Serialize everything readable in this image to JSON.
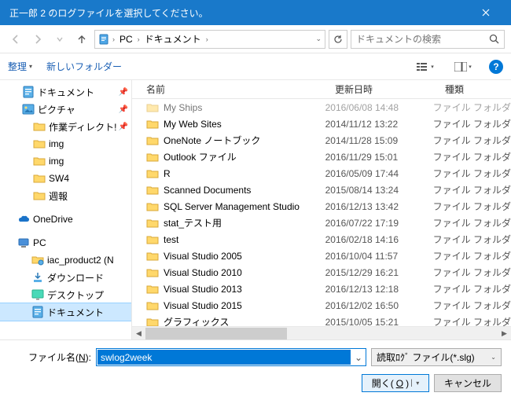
{
  "title": "正一郎 2 のログファイルを選択してください。",
  "breadcrumb": {
    "root": "PC",
    "folder": "ドキュメント"
  },
  "search_placeholder": "ドキュメントの検索",
  "toolbar": {
    "organize": "整理",
    "newfolder": "新しいフォルダー"
  },
  "columns": {
    "name": "名前",
    "date": "更新日時",
    "type": "種類"
  },
  "tree": [
    {
      "label": "ドキュメント",
      "icon": "doc",
      "indent": 28,
      "pin": true
    },
    {
      "label": "ピクチャ",
      "icon": "pic",
      "indent": 28,
      "pin": true
    },
    {
      "label": "作業ディレクト!",
      "icon": "folder",
      "indent": 42,
      "pin": true
    },
    {
      "label": "img",
      "icon": "folder",
      "indent": 42
    },
    {
      "label": "img",
      "icon": "folder",
      "indent": 42
    },
    {
      "label": "SW4",
      "icon": "folder",
      "indent": 42
    },
    {
      "label": "週報",
      "icon": "folder",
      "indent": 42
    },
    {
      "label": "",
      "icon": "",
      "indent": 0,
      "spacer": true
    },
    {
      "label": "OneDrive",
      "icon": "onedrive",
      "indent": 22
    },
    {
      "label": "",
      "icon": "",
      "indent": 0,
      "spacer": true
    },
    {
      "label": "PC",
      "icon": "pc",
      "indent": 22
    },
    {
      "label": "iac_product2 (N",
      "icon": "netfolder",
      "indent": 40
    },
    {
      "label": "ダウンロード",
      "icon": "download",
      "indent": 40
    },
    {
      "label": "デスクトップ",
      "icon": "desktop",
      "indent": 40
    },
    {
      "label": "ドキュメント",
      "icon": "doc",
      "indent": 40,
      "sel": true
    }
  ],
  "files": [
    {
      "name": "My Ships",
      "date": "2016/06/08 14:48",
      "type": "ファイル フォルダ"
    },
    {
      "name": "My Web Sites",
      "date": "2014/11/12 13:22",
      "type": "ファイル フォルダ"
    },
    {
      "name": "OneNote ノートブック",
      "date": "2014/11/28 15:09",
      "type": "ファイル フォルダ"
    },
    {
      "name": "Outlook ファイル",
      "date": "2016/11/29 15:01",
      "type": "ファイル フォルダ"
    },
    {
      "name": "R",
      "date": "2016/05/09 17:44",
      "type": "ファイル フォルダ"
    },
    {
      "name": "Scanned Documents",
      "date": "2015/08/14 13:24",
      "type": "ファイル フォルダ"
    },
    {
      "name": "SQL Server Management Studio",
      "date": "2016/12/13 13:42",
      "type": "ファイル フォルダ"
    },
    {
      "name": "stat_テスト用",
      "date": "2016/07/22 17:19",
      "type": "ファイル フォルダ"
    },
    {
      "name": "test",
      "date": "2016/02/18 14:16",
      "type": "ファイル フォルダ"
    },
    {
      "name": "Visual Studio 2005",
      "date": "2016/10/04 11:57",
      "type": "ファイル フォルダ"
    },
    {
      "name": "Visual Studio 2010",
      "date": "2015/12/29 16:21",
      "type": "ファイル フォルダ"
    },
    {
      "name": "Visual Studio 2013",
      "date": "2016/12/13 12:18",
      "type": "ファイル フォルダ"
    },
    {
      "name": "Visual Studio 2015",
      "date": "2016/12/02 16:50",
      "type": "ファイル フォルダ"
    },
    {
      "name": "グラフィックス",
      "date": "2015/10/05 15:21",
      "type": "ファイル フォルダ"
    }
  ],
  "filename_label_pre": "ファイル名(",
  "filename_label_key": "N",
  "filename_label_post": "):",
  "filename_value": "swlog2week",
  "filter_label": "読取ﾛｸﾞ ファイル(*.slg)",
  "open_pre": "開く(",
  "open_key": "O",
  "open_post": ")",
  "cancel_label": "キャンセル"
}
